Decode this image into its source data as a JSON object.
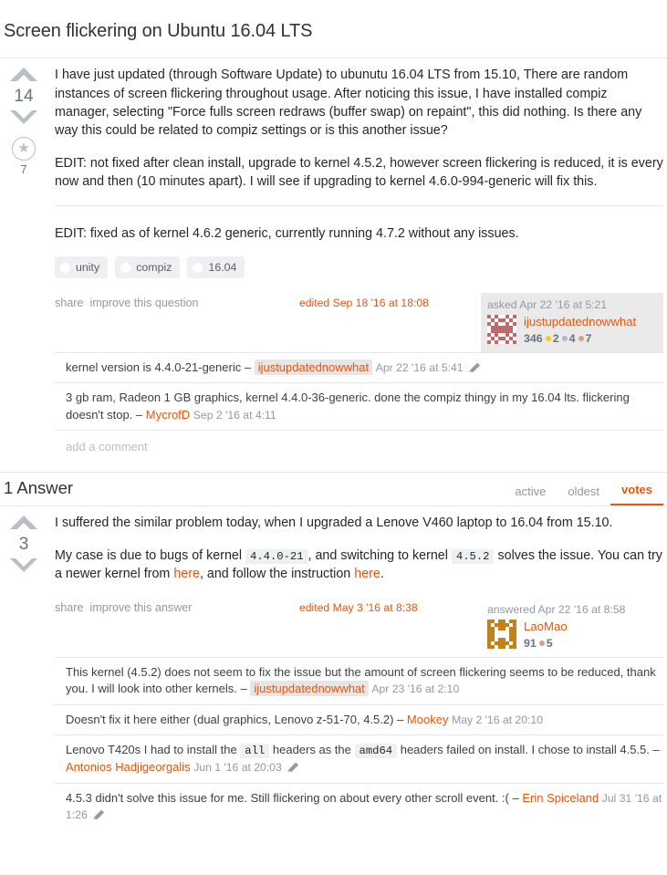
{
  "page": {
    "title": "Screen flickering on Ubuntu 16.04 LTS"
  },
  "question": {
    "vote_count": "14",
    "favorite_count": "7",
    "star_glyph": "★",
    "body": {
      "p1": "I have just updated (through Software Update) to ubunutu 16.04 LTS from 15.10, There are random instances of screen flickering throughout usage. After noticing this issue, I have installed compiz manager, selecting \"Force fulls screen redraws (buffer swap) on repaint\", this did nothing. Is there any way this could be related to compiz settings or is this another issue?",
      "p2": "EDIT: not fixed after clean install, upgrade to kernel 4.5.2, however screen flickering is reduced, it is every now and then (10 minutes apart). I will see if upgrading to kernel 4.6.0-994-generic will fix this.",
      "p3": "EDIT: fixed as of kernel 4.6.2 generic, currently running 4.7.2 without any issues."
    },
    "tags": [
      {
        "label": "unity"
      },
      {
        "label": "compiz"
      },
      {
        "label": "16.04"
      }
    ],
    "actions": {
      "share": "share",
      "improve": "improve this question"
    },
    "edited": "edited Sep 18 '16 at 18:08",
    "usercard": {
      "time": "asked Apr 22 '16 at 5:21",
      "name": "ijustupdatednowwhat",
      "reputation": "346",
      "gold": "2",
      "silver": "4",
      "bronze": "7"
    },
    "comments": [
      {
        "text": "kernel version is 4.4.0-21-generic –",
        "user": "ijustupdatednowwhat",
        "user_is_op": true,
        "date": "Apr 22 '16 at 5:41",
        "has_pencil": true
      },
      {
        "text": "3 gb ram, Radeon 1 GB graphics, kernel 4.4.0-36-generic. done the compiz thingy in my 16.04 lts. flickering doesn't stop. –",
        "user": "MycrofD",
        "user_is_op": false,
        "date": "Sep 2 '16 at 4:11",
        "has_pencil": false
      }
    ],
    "add_comment": "add a comment"
  },
  "answers_section": {
    "count_label": "1 Answer",
    "tabs": [
      {
        "label": "active",
        "active": false
      },
      {
        "label": "oldest",
        "active": false
      },
      {
        "label": "votes",
        "active": true
      }
    ]
  },
  "answer": {
    "vote_count": "3",
    "body": {
      "p1": "I suffered the similar problem today, when I upgraded a Lenove V460 laptop to 16.04 from 15.10.",
      "p2_a": "My case is due to bugs of kernel",
      "p2_code1": "4.4.0-21",
      "p2_b": ", and switching to kernel",
      "p2_code2": "4.5.2",
      "p2_c": "solves the issue. You can try a newer kernel from",
      "p2_link1": "here",
      "p2_d": ", and follow the instruction",
      "p2_link2": "here",
      "p2_e": "."
    },
    "actions": {
      "share": "share",
      "improve": "improve this answer"
    },
    "edited": "edited May 3 '16 at 8:38",
    "usercard": {
      "time": "answered Apr 22 '16 at 8:58",
      "name": "LaoMao",
      "reputation": "91",
      "bronze": "5"
    },
    "comments": [
      {
        "text": "This kernel (4.5.2) does not seem to fix the issue but the amount of screen flickering seems to be reduced, thank you. I will look into other kernels. –",
        "user": "ijustupdatednowwhat",
        "user_is_op": true,
        "date": "Apr 23 '16 at 2:10",
        "has_pencil": false
      },
      {
        "text": "Doesn't fix it here either (dual graphics, Lenovo z-51-70, 4.5.2) –",
        "user": "Mookey",
        "user_is_op": false,
        "date": "May 2 '16 at 20:10",
        "has_pencil": false
      },
      {
        "text_a": "Lenovo T420s I had to install the",
        "code1": "all",
        "text_b": "headers as the",
        "code2": "amd64",
        "text_c": "headers failed on install. I chose to install 4.5.5. –",
        "user": "Antonios Hadjigeorgalis",
        "user_is_op": false,
        "date": "Jun 1 '16 at 20:03",
        "has_pencil": true
      },
      {
        "text": "4.5.3 didn't solve this issue for me. Still flickering on about every other scroll event. :( –",
        "user": "Erin Spiceland",
        "user_is_op": false,
        "date": "Jul 31 '16 at 1:26",
        "has_pencil": true
      }
    ]
  },
  "colors": {
    "link_orange": "#e8560d",
    "muted_gray": "#9199a1",
    "text": "#242729",
    "arrow_gray": "#babfc4",
    "gold": "#ffcc01",
    "silver": "#b4b8bc",
    "bronze": "#d1a684",
    "avatar_question": "#c06a6a",
    "avatar_answer": "#c2821a"
  }
}
